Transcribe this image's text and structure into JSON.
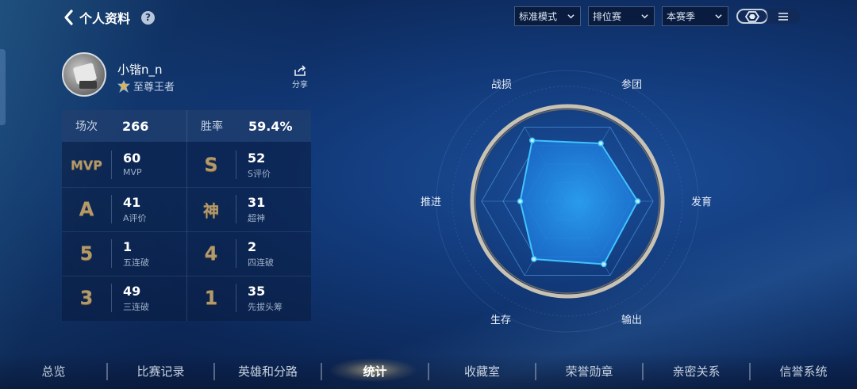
{
  "header": {
    "title": "个人资料",
    "help_label": "?"
  },
  "filters": [
    {
      "value": "标准模式"
    },
    {
      "value": "排位赛"
    },
    {
      "value": "本赛季"
    }
  ],
  "profile": {
    "name": "小锴n_n",
    "rank": "至尊王者",
    "share_label": "分享"
  },
  "stats": {
    "matches_label": "场次",
    "matches_value": "266",
    "winrate_label": "胜率",
    "winrate_value": "59.4%",
    "cells": [
      {
        "icon_text": "MVP",
        "value": "60",
        "label": "MVP"
      },
      {
        "icon_text": "S",
        "value": "52",
        "label": "S评价"
      },
      {
        "icon_text": "A",
        "value": "41",
        "label": "A评价"
      },
      {
        "icon_text": "神",
        "value": "31",
        "label": "超神"
      },
      {
        "icon_text": "5",
        "value": "1",
        "label": "五连破"
      },
      {
        "icon_text": "4",
        "value": "2",
        "label": "四连破"
      },
      {
        "icon_text": "3",
        "value": "49",
        "label": "三连破"
      },
      {
        "icon_text": "1",
        "value": "35",
        "label": "先拔头筹"
      }
    ]
  },
  "radar": {
    "labels": {
      "top_left": "战损",
      "top_right": "参团",
      "right": "发育",
      "bottom_right": "输出",
      "bottom_left": "生存",
      "left": "推进"
    },
    "values": {
      "top_left": 0.82,
      "top_right": 0.78,
      "right": 0.82,
      "bottom_right": 0.85,
      "bottom_left": 0.78,
      "left": 0.55
    },
    "accent_color": "#3fc3ff"
  },
  "nav": {
    "items": [
      "总览",
      "比赛记录",
      "英雄和分路",
      "统计",
      "收藏室",
      "荣誉勋章",
      "亲密关系",
      "信誉系统"
    ],
    "active": "统计"
  },
  "colors": {
    "gold": "#b49a6a",
    "background": "#123a7a"
  }
}
